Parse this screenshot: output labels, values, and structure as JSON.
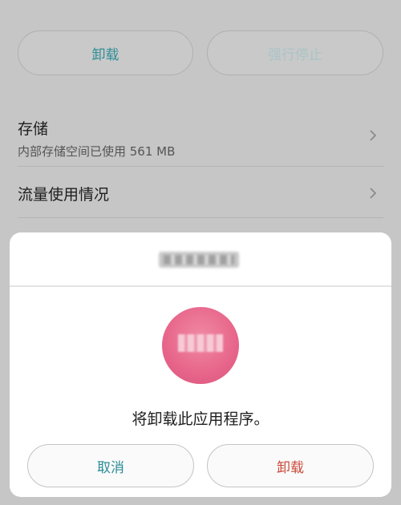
{
  "app_info": {
    "uninstall_label": "卸载",
    "force_stop_label": "强行停止",
    "storage": {
      "title": "存储",
      "subtitle": "内部存储空间已使用 561 MB"
    },
    "data_usage": {
      "title": "流量使用情况"
    }
  },
  "dialog": {
    "message": "将卸载此应用程序。",
    "cancel_label": "取消",
    "confirm_label": "卸载"
  },
  "icons": {
    "chevron": "chevron-right-icon",
    "app": "app-icon"
  },
  "colors": {
    "accent_teal": "#2e8e97",
    "danger_red": "#c94a3a",
    "dimmed_disabled": "#a9c4c7",
    "app_icon_pink": "#e7658a"
  }
}
